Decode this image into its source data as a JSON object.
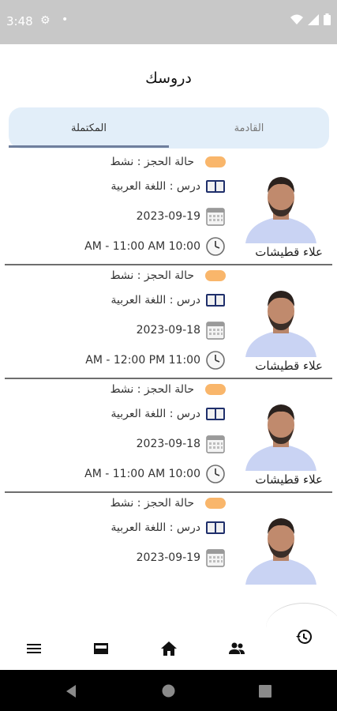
{
  "status_bar": {
    "time": "3:48"
  },
  "header": {
    "title": "دروسك"
  },
  "tabs": {
    "completed": "المكتملة",
    "upcoming": "القادمة"
  },
  "lessons": [
    {
      "status": "حالة الحجز : نشط",
      "lesson": "درس :  اللغة العربية",
      "date": "2023-09-19",
      "time": "AM - 11:00 AM 10:00",
      "teacher": "علاء قطيشات"
    },
    {
      "status": "حالة الحجز : نشط",
      "lesson": "درس :  اللغة العربية",
      "date": "2023-09-18",
      "time": "AM - 12:00 PM 11:00",
      "teacher": "علاء قطيشات"
    },
    {
      "status": "حالة الحجز : نشط",
      "lesson": "درس :  اللغة العربية",
      "date": "2023-09-18",
      "time": "AM - 11:00 AM 10:00",
      "teacher": "علاء قطيشات"
    },
    {
      "status": "حالة الحجز : نشط",
      "lesson": "درس :  اللغة العربية",
      "date": "2023-09-19",
      "time": "",
      "teacher": ""
    }
  ],
  "colors": {
    "status_pill": "#f9b66b",
    "tab_bg": "#e2eef9",
    "tab_indicator": "#6f7f9d",
    "status_bar": "#c8c8c8"
  },
  "bottom_nav": [
    "menu-icon",
    "inbox-icon",
    "home-icon",
    "people-icon",
    "history-icon"
  ]
}
